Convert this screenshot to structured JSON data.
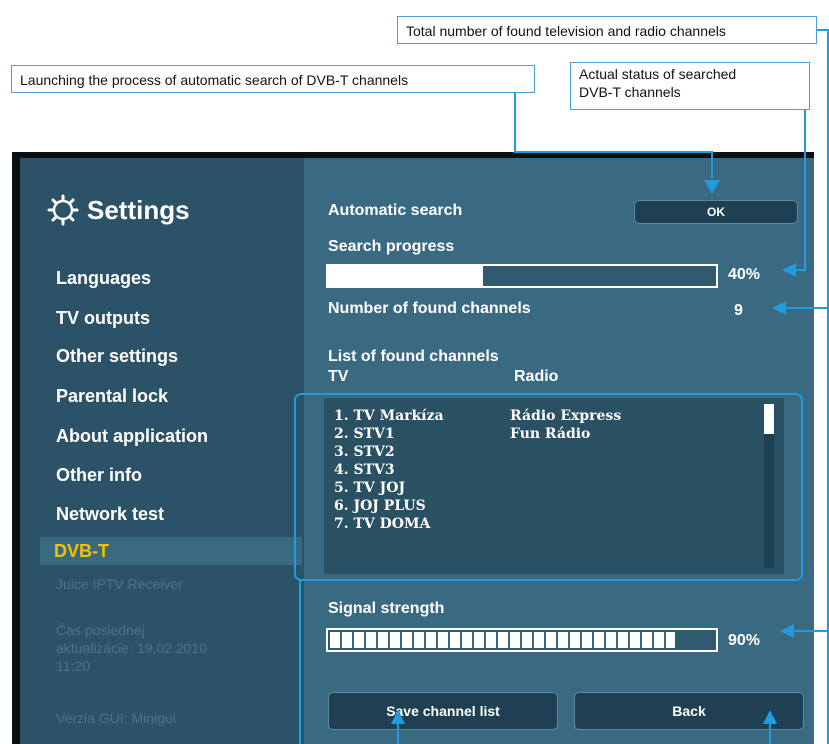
{
  "callouts": {
    "total_channels": "Total number of found television and radio channels",
    "launch_search": "Launching the process of automatic search of DVB-T channels",
    "status_line1": "Actual status of searched",
    "status_line2": "DVB-T channels"
  },
  "sidebar": {
    "title": "Settings",
    "items": [
      {
        "label": "Languages"
      },
      {
        "label": "TV outputs"
      },
      {
        "label": "Other settings"
      },
      {
        "label": "Parental lock"
      },
      {
        "label": "About application"
      },
      {
        "label": "Other info"
      },
      {
        "label": "Network test"
      },
      {
        "label": "DVB-T"
      }
    ],
    "footer": {
      "app_name": "Juice IPTV Receiver",
      "update_line1": "Čas poslednej",
      "update_line2": "aktualizácie: 19.02.2010",
      "update_line3": "11:20",
      "gui_version": "Verzia GUI: Minigui"
    }
  },
  "main": {
    "auto_search_label": "Automatic search",
    "ok_label": "OK",
    "progress_label": "Search progress",
    "progress_value": "40%",
    "progress_fraction": 0.4,
    "found_label": "Number of found channels",
    "found_count": "9",
    "list_title": "List of found channels",
    "col_tv": "TV",
    "col_radio": "Radio",
    "tv_channels": [
      "1. TV Markíza",
      "2. STV1",
      "3. STV2",
      "4. STV3",
      "5. TV JOJ",
      "6. JOJ PLUS",
      "7. TV DOMA"
    ],
    "radio_channels": [
      "Rádio Express",
      "Fun Rádio"
    ],
    "signal_label": "Signal strength",
    "signal_value": "90%",
    "signal_fraction": 0.9,
    "save_label": "Save channel list",
    "back_label": "Back"
  },
  "colors": {
    "sidebar_bg": "#2b5266",
    "panel_bg": "#3a6a82",
    "active_text": "#f3c300",
    "callout_line": "#1f9be0"
  }
}
